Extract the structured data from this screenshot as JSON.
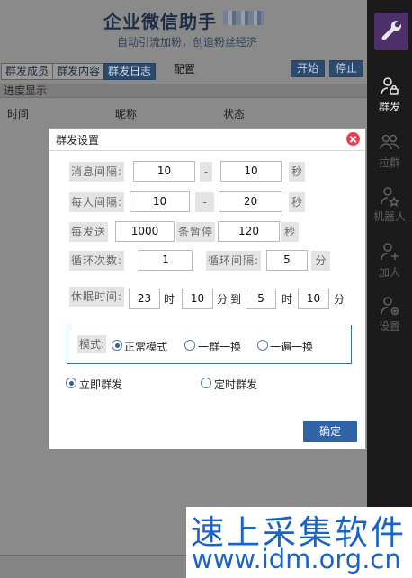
{
  "app": {
    "title": "企业微信助手",
    "subtitle": "自动引流加粉，创造粉丝经济"
  },
  "tabs": [
    {
      "label": "群发成员"
    },
    {
      "label": "群发内容"
    },
    {
      "label": "群发日志",
      "active": true
    }
  ],
  "config_label": "配置",
  "controls": {
    "start": "开始",
    "stop": "停止"
  },
  "progress_label": "进度显示",
  "table_headers": [
    "时间",
    "昵称",
    "状态"
  ],
  "sidebar": {
    "items": [
      {
        "label": "群发",
        "icon": "user-broadcast-icon",
        "active": true
      },
      {
        "label": "拉群",
        "icon": "group-icon"
      },
      {
        "label": "机器人",
        "icon": "robot-user-icon"
      },
      {
        "label": "加人",
        "icon": "add-user-icon"
      },
      {
        "label": "设置",
        "icon": "user-settings-icon"
      }
    ]
  },
  "dialog": {
    "title": "群发设置",
    "msg_interval": {
      "label": "消息间隔:",
      "from": "10",
      "sep": "-",
      "to": "10",
      "unit": "秒"
    },
    "person_interval": {
      "label": "每人间隔:",
      "from": "10",
      "sep": "-",
      "to": "20",
      "unit": "秒"
    },
    "batch": {
      "label": "每发送",
      "count": "1000",
      "mid_label": "条暂停",
      "pause": "120",
      "unit": "秒"
    },
    "loop": {
      "count_label": "循环次数:",
      "count": "1",
      "interval_label": "循环间隔:",
      "interval": "5",
      "unit": "分"
    },
    "sleep": {
      "label": "休眠时间:",
      "start_h": "23",
      "h_unit": "时",
      "start_m": "10",
      "m_unit": "分",
      "to": "到",
      "end_h": "5",
      "end_h_unit": "时",
      "end_m": "10",
      "end_m_unit": "分"
    },
    "mode": {
      "label": "模式:",
      "options": [
        "正常模式",
        "一群一换",
        "一遍一换"
      ],
      "selected": 0
    },
    "send_time": {
      "options": [
        "立即群发",
        "定时群发"
      ],
      "selected": 0
    },
    "confirm": "确定"
  },
  "watermark": {
    "text": "速上采集软件",
    "url": "www.idm.org.cn"
  },
  "colors": {
    "accent": "#2f64a8",
    "close": "#e5424b",
    "sidebar": "#1b1b1b",
    "logo": "#4d2f6a"
  }
}
